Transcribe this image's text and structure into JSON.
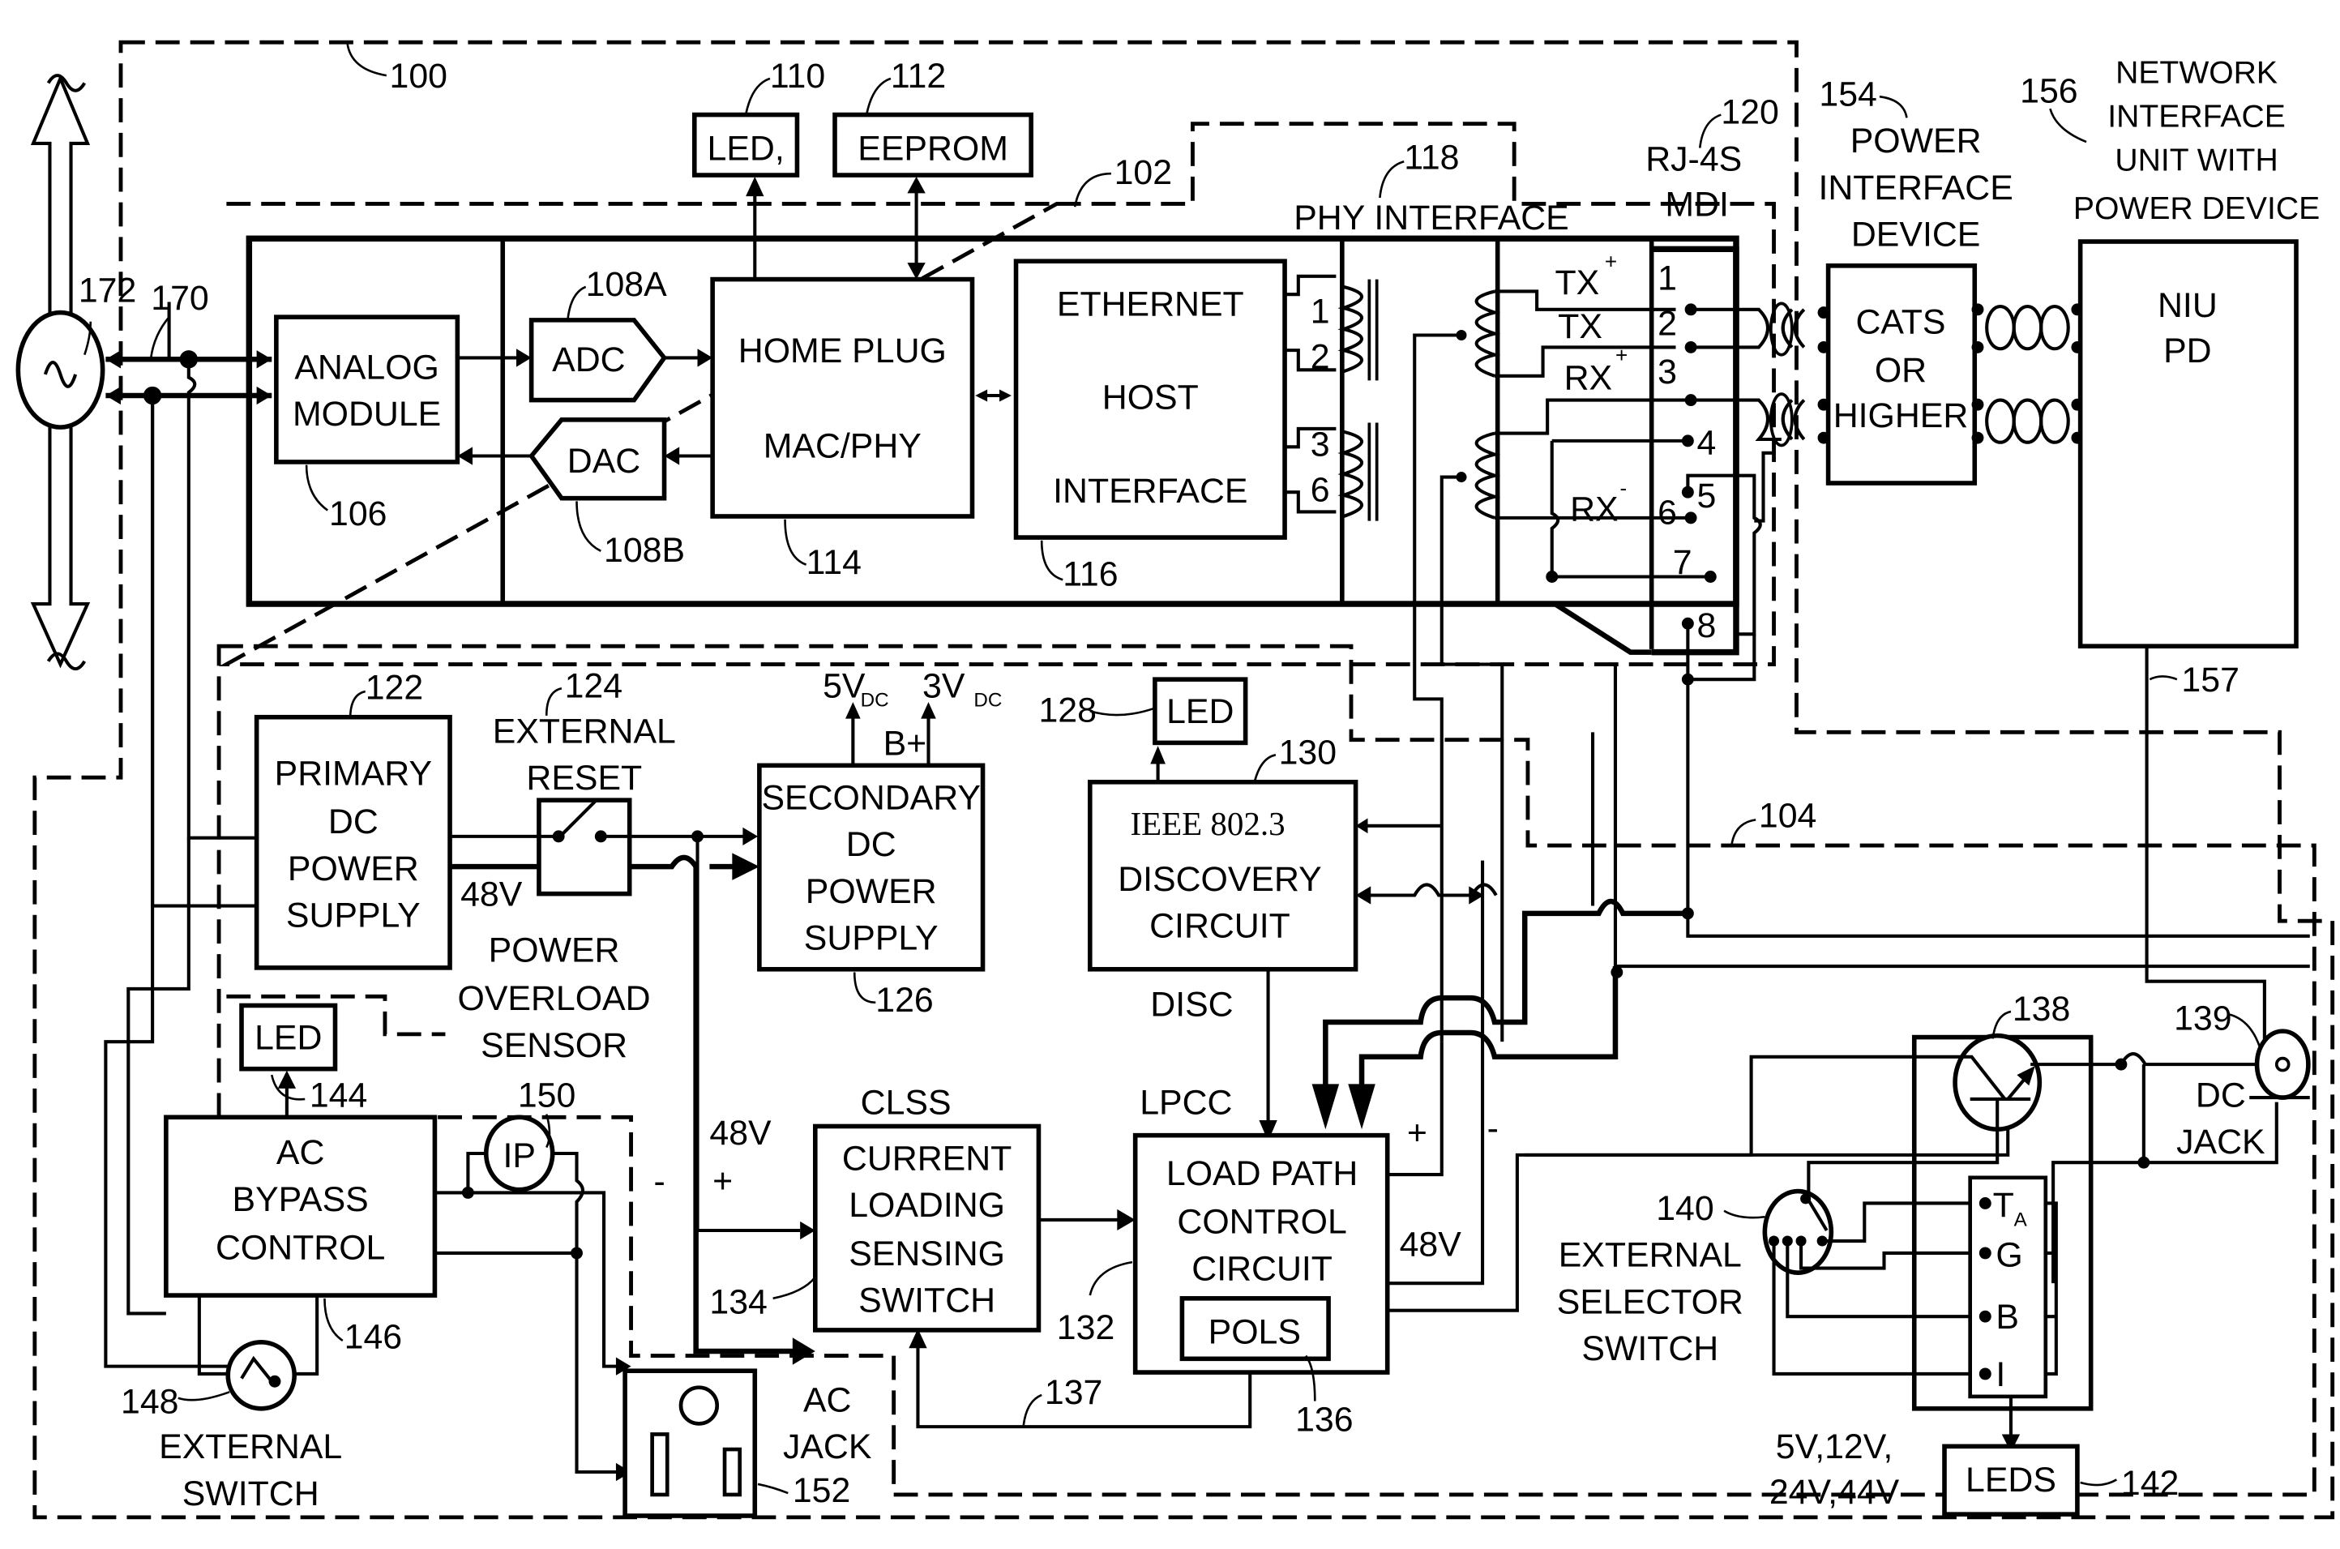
{
  "figure": {
    "type": "patent block diagram",
    "subject": "HomePlug powerline Ethernet adapter with Power-over-Ethernet power sourcing"
  },
  "reference_numerals": {
    "outer_device": "100",
    "network_section": "102",
    "power_section": "104",
    "analog_module": "106",
    "adc": "108A",
    "dac": "108B",
    "led_top": "110",
    "eeprom": "112",
    "homeplug": "114",
    "ethernet_host": "116",
    "phy_interface": "118",
    "rj45": "120",
    "primary_dc": "122",
    "external_reset": "124",
    "secondary_dc": "126",
    "led_discovery": "128",
    "discovery": "130",
    "lpcc": "132",
    "clss_input": "134",
    "pols": "136",
    "feedback": "137",
    "transistor": "138",
    "dc_jack": "139",
    "selector": "140",
    "leds": "142",
    "led_ac": "144",
    "ac_bypass": "146",
    "external_switch": "148",
    "ip_sensor": "150",
    "ac_jack": "152",
    "power_interface": "154",
    "niu": "156",
    "niu_line": "157",
    "powerline": "170",
    "ac_source": "172"
  },
  "blocks": {
    "analog_module": [
      "ANALOG",
      "MODULE"
    ],
    "adc": "ADC",
    "dac": "DAC",
    "led_top": "LED,",
    "eeprom": "EEPROM",
    "homeplug": [
      "HOME PLUG",
      "MAC/PHY"
    ],
    "ethernet_host": [
      "ETHERNET",
      "HOST",
      "INTERFACE"
    ],
    "phy_interface_label": "PHY INTERFACE",
    "rj45_label": [
      "RJ-4S",
      "MDI"
    ],
    "signals": {
      "tx_plus": "TX",
      "tx_minus": "TX",
      "rx_plus": "RX",
      "rx_minus": "RX",
      "plus": "+",
      "minus": "-"
    },
    "transformer_pins": [
      "1",
      "2",
      "3",
      "6"
    ],
    "rj45_pins": [
      "1",
      "2",
      "3",
      "4",
      "5",
      "6",
      "7",
      "8"
    ],
    "power_interface_label": [
      "POWER",
      "INTERFACE",
      "DEVICE"
    ],
    "cable_box": [
      "CATS",
      "OR",
      "HIGHER"
    ],
    "niu_label": [
      "NETWORK",
      "INTERFACE",
      "UNIT WITH",
      "POWER DEVICE"
    ],
    "niu_box": [
      "NIU",
      "PD"
    ],
    "primary_dc": [
      "PRIMARY",
      "DC",
      "POWER",
      "SUPPLY"
    ],
    "external_reset": [
      "EXTERNAL",
      "RESET"
    ],
    "v48": "48V",
    "power_overload": [
      "POWER",
      "OVERLOAD",
      "SENSOR"
    ],
    "secondary_dc": [
      "SECONDARY",
      "DC",
      "POWER",
      "SUPPLY"
    ],
    "rails": {
      "v5": "5V",
      "v3": "3V",
      "dc": "DC",
      "bplus": "B+"
    },
    "led": "LED",
    "discovery": [
      "IEEE 802.3",
      "DISCOVERY",
      "CIRCUIT"
    ],
    "disc_signal": "DISC",
    "lpcc_signal": "LPCC",
    "clss_signal": "CLSS",
    "clss": [
      "CURRENT",
      "LOADING",
      "SENSING",
      "SWITCH"
    ],
    "lpcc": [
      "LOAD PATH",
      "CONTROL",
      "CIRCUIT"
    ],
    "pols": "POLS",
    "ac_bypass": [
      "AC",
      "BYPASS",
      "CONTROL"
    ],
    "ip": "IP",
    "external_switch": [
      "EXTERNAL",
      "SWITCH"
    ],
    "ac_jack": [
      "AC",
      "JACK"
    ],
    "selector": [
      "EXTERNAL",
      "SELECTOR",
      "SWITCH"
    ],
    "selector_pins": {
      "ta": "T",
      "ta_sub": "A",
      "g": "G",
      "b": "B",
      "i": "I"
    },
    "dc_jack": [
      "DC",
      "JACK"
    ],
    "voltages": [
      "5V,12V,",
      "24V,44V"
    ],
    "leds": "LEDS"
  }
}
